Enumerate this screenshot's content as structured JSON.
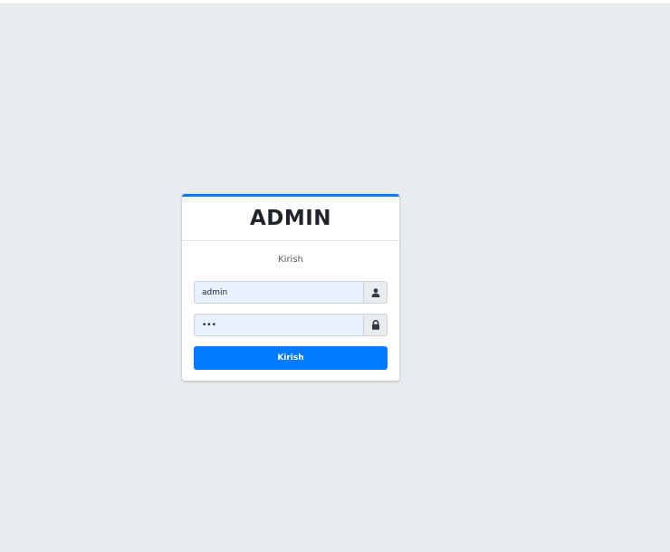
{
  "login": {
    "brand_title": "ADMIN",
    "message": "Kirish",
    "username": {
      "value": "admin",
      "icon": "user-icon"
    },
    "password": {
      "value": "***",
      "icon": "lock-icon"
    },
    "submit_label": "Kirish"
  },
  "colors": {
    "accent": "#007bff",
    "background": "#e9ecef",
    "input_autofill": "#e8f0fe"
  }
}
